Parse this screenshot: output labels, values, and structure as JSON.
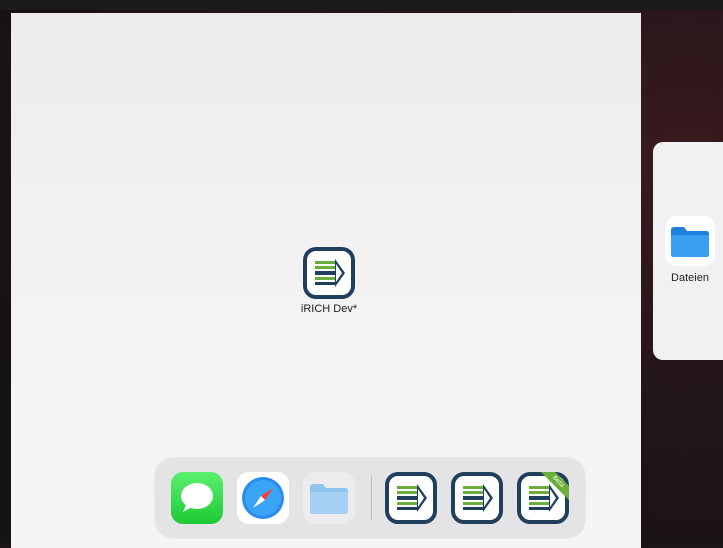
{
  "center_app": {
    "label": "iRICH Dev*",
    "icon": "irich-dev-icon"
  },
  "side_card": {
    "app_label": "Dateien",
    "icon": "files-folder-icon"
  },
  "dock": {
    "apps": [
      {
        "name": "messages",
        "icon": "messages-icon"
      },
      {
        "name": "safari",
        "icon": "safari-icon"
      },
      {
        "name": "files",
        "icon": "files-folder-icon"
      },
      {
        "name": "irich-1",
        "icon": "irich-icon"
      },
      {
        "name": "irich-2",
        "icon": "irich-icon"
      },
      {
        "name": "irich-3",
        "icon": "irich-beta-icon",
        "badge": "Beta"
      }
    ]
  },
  "colors": {
    "irich_navy": "#1f3f5c",
    "irich_green": "#6cae3b",
    "messages_green": "#1ec934",
    "folder_blue": "#3a9ff0"
  }
}
